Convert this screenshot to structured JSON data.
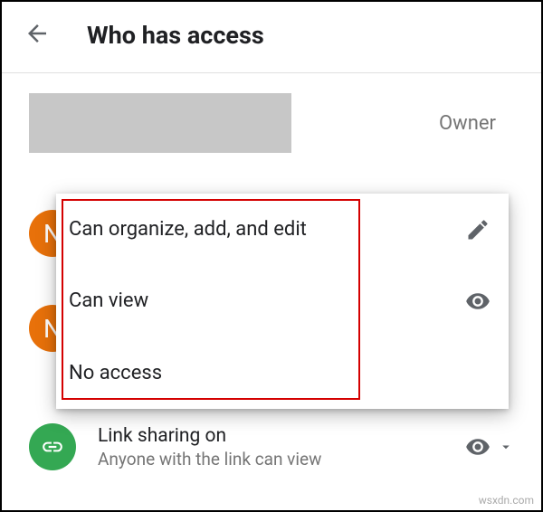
{
  "header": {
    "title": "Who has access"
  },
  "owner": {
    "role_label": "Owner"
  },
  "bg_avatars": {
    "initial1": "N",
    "initial2": "N"
  },
  "popup": {
    "options": [
      {
        "label": "Can organize, add, and edit",
        "icon": "pencil"
      },
      {
        "label": "Can view",
        "icon": "eye"
      },
      {
        "label": "No access",
        "icon": ""
      }
    ]
  },
  "link_sharing": {
    "title": "Link sharing on",
    "subtitle": "Anyone with the link can view"
  },
  "watermark": "wsxdn.com"
}
